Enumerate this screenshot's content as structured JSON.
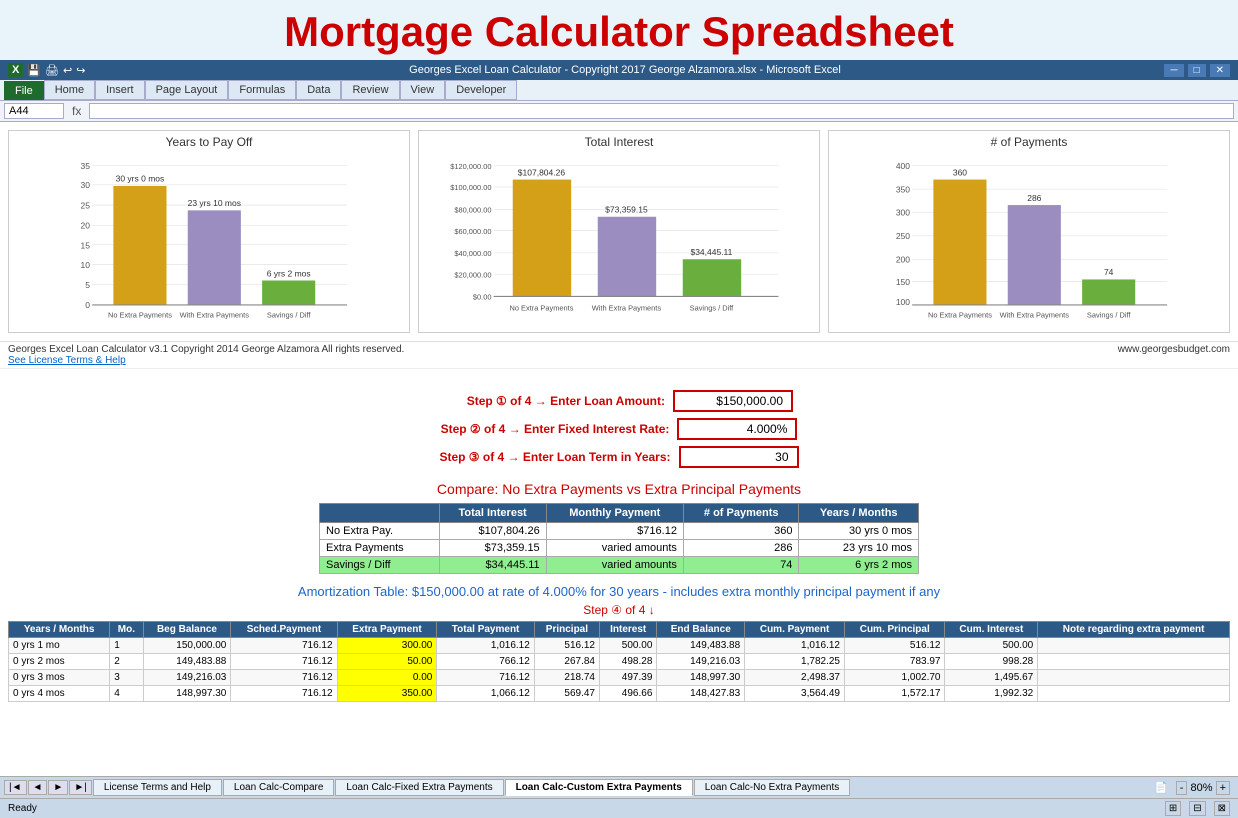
{
  "title": "Mortgage Calculator Spreadsheet",
  "excel": {
    "title_bar": "Georges Excel Loan Calculator -  Copyright 2017 George Alzamora.xlsx - Microsoft Excel",
    "cell_ref": "A44",
    "formula": "",
    "ribbon_tabs": [
      "File",
      "Home",
      "Insert",
      "Page Layout",
      "Formulas",
      "Data",
      "Review",
      "View",
      "Developer"
    ],
    "active_tab": "File"
  },
  "charts": {
    "chart1": {
      "title": "Years to Pay Off",
      "bars": [
        {
          "label": "No Extra Payments",
          "value": 30,
          "color": "#d4a017",
          "text": "30 yrs 0 mos"
        },
        {
          "label": "With Extra Payments",
          "value": 23.83,
          "color": "#9b8dc0",
          "text": "23 yrs 10 mos"
        },
        {
          "label": "Savings / Diff",
          "value": 6.17,
          "color": "#6aaf3e",
          "text": "6 yrs 2 mos"
        }
      ],
      "max": 35
    },
    "chart2": {
      "title": "Total Interest",
      "bars": [
        {
          "label": "No Extra Payments",
          "value": 107804.26,
          "color": "#d4a017",
          "text": "$107,804.26"
        },
        {
          "label": "With Extra Payments",
          "value": 73359.15,
          "color": "#9b8dc0",
          "text": "$73,359.15"
        },
        {
          "label": "Savings / Diff",
          "value": 34445.11,
          "color": "#6aaf3e",
          "text": "$34,445.11"
        }
      ],
      "max": 120000,
      "yLabels": [
        "$0.00",
        "$20,000.00",
        "$40,000.00",
        "$60,000.00",
        "$80,000.00",
        "$100,000.00",
        "$120,000.00"
      ]
    },
    "chart3": {
      "title": "# of Payments",
      "bars": [
        {
          "label": "No Extra Payments",
          "value": 360,
          "color": "#d4a017",
          "text": "360"
        },
        {
          "label": "With Extra Payments",
          "value": 286,
          "color": "#9b8dc0",
          "text": "286"
        },
        {
          "label": "Savings / Diff",
          "value": 74,
          "color": "#6aaf3e",
          "text": "74"
        }
      ],
      "max": 400
    }
  },
  "footer_info": {
    "left": "Georges Excel Loan Calculator v3.1    Copyright 2014  George Alzamora  All rights reserved.",
    "right": "www.georgesbudget.com",
    "license": "See License Terms & Help"
  },
  "steps": {
    "step1": {
      "label": "Step ① of 4 →  Enter Loan Amount:",
      "value": "$150,000.00"
    },
    "step2": {
      "label": "Step ② of 4 →  Enter Fixed Interest Rate:",
      "value": "4.000%"
    },
    "step3": {
      "label": "Step ③ of 4 →  Enter Loan Term in Years:",
      "value": "30"
    }
  },
  "compare": {
    "title": "Compare: No Extra Payments vs Extra Principal Payments",
    "headers": [
      "",
      "Total Interest",
      "Monthly Payment",
      "# of Payments",
      "Years / Months"
    ],
    "rows": [
      {
        "label": "No Extra Pay.",
        "total_interest": "$107,804.26",
        "monthly_payment": "$716.12",
        "num_payments": "360",
        "years_months": "30 yrs 0 mos"
      },
      {
        "label": "Extra Payments",
        "total_interest": "$73,359.15",
        "monthly_payment": "varied amounts",
        "num_payments": "286",
        "years_months": "23 yrs 10 mos"
      },
      {
        "label": "Savings / Diff",
        "total_interest": "$34,445.11",
        "monthly_payment": "varied amounts",
        "num_payments": "74",
        "years_months": "6 yrs 2 mos"
      }
    ]
  },
  "amortization": {
    "title": "Amortization Table:  $150,000.00 at rate of 4.000% for 30 years - includes extra monthly principal payment if any",
    "step4_label": "Step ④ of 4 ↓",
    "headers": [
      "Years / Months",
      "Mo.",
      "Beg Balance",
      "Sched.Payment",
      "Extra Payment",
      "Total Payment",
      "Principal",
      "Interest",
      "End Balance",
      "Cum. Payment",
      "Cum. Principal",
      "Cum. Interest",
      "Note regarding extra payment"
    ],
    "rows": [
      {
        "years_months": "0 yrs 1 mo",
        "mo": "1",
        "beg_balance": "150,000.00",
        "sched_payment": "716.12",
        "extra_payment": "300.00",
        "total_payment": "1,016.12",
        "principal": "516.12",
        "interest": "500.00",
        "end_balance": "149,483.88",
        "cum_payment": "1,016.12",
        "cum_principal": "516.12",
        "cum_interest": "500.00",
        "note": "",
        "extra_highlight": true
      },
      {
        "years_months": "0 yrs 2 mos",
        "mo": "2",
        "beg_balance": "149,483.88",
        "sched_payment": "716.12",
        "extra_payment": "50.00",
        "total_payment": "766.12",
        "principal": "267.84",
        "interest": "498.28",
        "end_balance": "149,216.03",
        "cum_payment": "1,782.25",
        "cum_principal": "783.97",
        "cum_interest": "998.28",
        "note": "",
        "extra_highlight": true
      },
      {
        "years_months": "0 yrs 3 mos",
        "mo": "3",
        "beg_balance": "149,216.03",
        "sched_payment": "716.12",
        "extra_payment": "0.00",
        "total_payment": "716.12",
        "principal": "218.74",
        "interest": "497.39",
        "end_balance": "148,997.30",
        "cum_payment": "2,498.37",
        "cum_principal": "1,002.70",
        "cum_interest": "1,495.67",
        "note": "",
        "extra_highlight": false,
        "zero_payment": true
      },
      {
        "years_months": "0 yrs 4 mos",
        "mo": "4",
        "beg_balance": "148,997.30",
        "sched_payment": "716.12",
        "extra_payment": "350.00",
        "total_payment": "1,066.12",
        "principal": "569.47",
        "interest": "496.66",
        "end_balance": "148,427.83",
        "cum_payment": "3,564.49",
        "cum_principal": "1,572.17",
        "cum_interest": "1,992.32",
        "note": "",
        "extra_highlight": true
      }
    ]
  },
  "sheet_tabs": [
    {
      "label": "License Terms and Help",
      "active": false
    },
    {
      "label": "Loan Calc-Compare",
      "active": false
    },
    {
      "label": "Loan Calc-Fixed Extra Payments",
      "active": false
    },
    {
      "label": "Loan Calc-Custom Extra Payments",
      "active": true
    },
    {
      "label": "Loan Calc-No Extra Payments",
      "active": false
    }
  ],
  "status": {
    "ready": "Ready",
    "zoom": "80%"
  }
}
